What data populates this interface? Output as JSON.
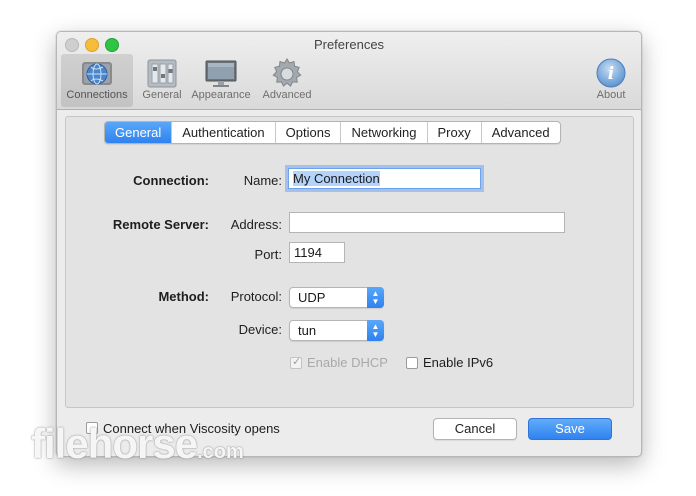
{
  "window": {
    "title": "Preferences"
  },
  "toolbar": {
    "items": [
      {
        "label": "Connections",
        "icon": "connections-globe-icon"
      },
      {
        "label": "General",
        "icon": "general-switches-icon"
      },
      {
        "label": "Appearance",
        "icon": "appearance-monitor-icon"
      },
      {
        "label": "Advanced",
        "icon": "advanced-gear-icon"
      }
    ],
    "about": {
      "label": "About",
      "icon": "info-icon",
      "glyph": "i"
    }
  },
  "tabs": [
    "General",
    "Authentication",
    "Options",
    "Networking",
    "Proxy",
    "Advanced"
  ],
  "form": {
    "connection": {
      "section": "Connection:",
      "name_label": "Name:",
      "name_value": "My Connection"
    },
    "remote": {
      "section": "Remote Server:",
      "address_label": "Address:",
      "address_value": "",
      "port_label": "Port:",
      "port_value": "1194"
    },
    "method": {
      "section": "Method:",
      "protocol_label": "Protocol:",
      "protocol_value": "UDP",
      "device_label": "Device:",
      "device_value": "tun"
    },
    "enable_dhcp": {
      "label": "Enable DHCP",
      "checked": true,
      "disabled": true
    },
    "enable_ipv6": {
      "label": "Enable IPv6",
      "checked": false
    }
  },
  "footer": {
    "connect_on_open": {
      "label": "Connect when Viscosity opens",
      "checked": false
    },
    "cancel_label": "Cancel",
    "save_label": "Save"
  },
  "watermark": {
    "text": "filehorse",
    "suffix": ".com"
  },
  "colors": {
    "accent": "#2f82f0",
    "selection": "#b4d3fb"
  }
}
